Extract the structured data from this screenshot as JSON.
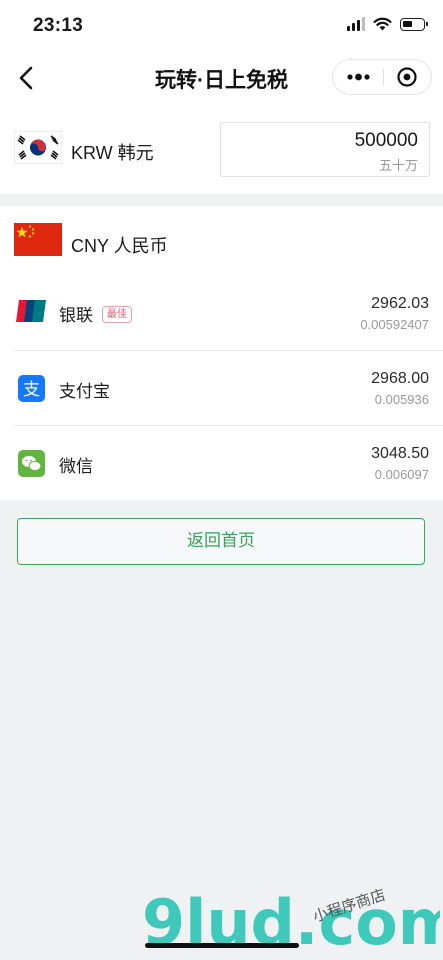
{
  "status_bar": {
    "time": "23:13"
  },
  "nav": {
    "title": "玩转·日上免税"
  },
  "from": {
    "currency_label": "KRW 韩元",
    "amount": "500000",
    "amount_words": "五十万"
  },
  "to": {
    "currency_label": "CNY 人民币",
    "methods": [
      {
        "name": "银联",
        "badge": "最佳",
        "amount": "2962.03",
        "rate": "0.00592407",
        "icon": "unionpay-icon"
      },
      {
        "name": "支付宝",
        "amount": "2968.00",
        "rate": "0.005936",
        "icon": "alipay-icon"
      },
      {
        "name": "微信",
        "amount": "3048.50",
        "rate": "0.006097",
        "icon": "wechat-icon"
      }
    ]
  },
  "home_button_label": "返回首页",
  "watermark": {
    "logo": "9lud.com",
    "tagline": "小程序商店"
  },
  "colors": {
    "accent_green": "#3fa35e",
    "badge_red": "#e2606b",
    "alipay_blue": "#1677ff",
    "wechat_green": "#62b53f",
    "china_red": "#de2910"
  }
}
